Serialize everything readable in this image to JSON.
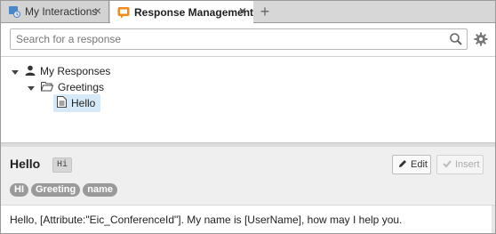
{
  "tabs": [
    {
      "label": "My Interactions",
      "icon": "interactions-icon",
      "active": false
    },
    {
      "label": "Response Management",
      "icon": "response-management-icon",
      "active": true
    }
  ],
  "search": {
    "placeholder": "Search for a response",
    "value": ""
  },
  "tree": {
    "root": {
      "label": "My Responses",
      "icon": "user-icon",
      "expanded": true
    },
    "folder": {
      "label": "Greetings",
      "icon": "folder-open-icon",
      "expanded": true
    },
    "item": {
      "label": "Hello",
      "icon": "document-icon",
      "selected": true
    }
  },
  "detail": {
    "title": "Hello",
    "shortcut": "Hi",
    "edit_label": "Edit",
    "insert_label": "Insert",
    "tags": [
      "HI",
      "Greeting",
      "name"
    ],
    "body": "Hello, [Attribute:\"Eic_ConferenceId\"]. My name is [UserName], how may I help you."
  },
  "colors": {
    "selected_bg": "#d6e9f8",
    "tag_bg": "#9a9a9a",
    "tab_icon_orange": "#f08a1c",
    "tab_icon_blue": "#4a86c8"
  }
}
